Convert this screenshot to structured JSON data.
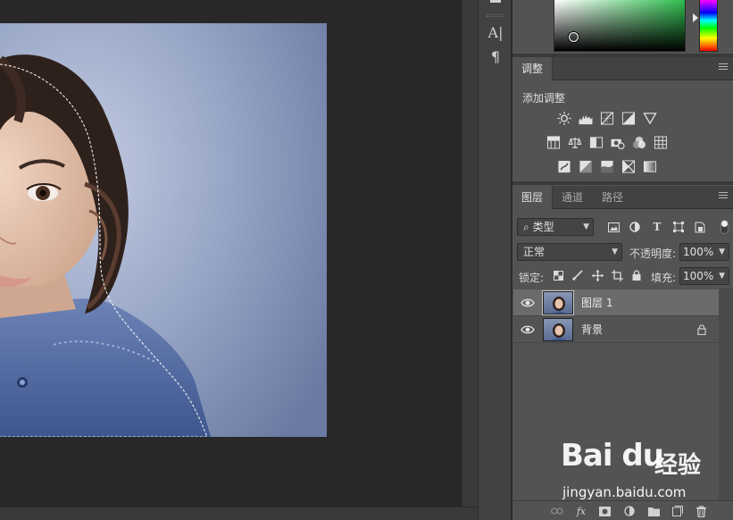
{
  "tools": {
    "type_tool": "A|",
    "paragraph_tool": "¶"
  },
  "adjustments": {
    "tab": "调整",
    "add_label": "添加调整",
    "icons": [
      "brightness-contrast-icon",
      "levels-icon",
      "curves-icon",
      "exposure-icon",
      "vibrance-icon",
      "hue-saturation-icon",
      "color-balance-icon",
      "black-white-icon",
      "photo-filter-icon",
      "channel-mixer-icon",
      "color-lookup-icon",
      "invert-icon",
      "posterize-icon",
      "threshold-icon",
      "selective-color-icon",
      "gradient-map-icon"
    ]
  },
  "layers_panel": {
    "tabs": [
      "图层",
      "通道",
      "路径"
    ],
    "filter": {
      "search_glyph": "⌕",
      "value": "类型"
    },
    "blend_mode": "正常",
    "opacity_label": "不透明度:",
    "opacity_value": "100%",
    "lock_label": "锁定:",
    "fill_label": "填充:",
    "fill_value": "100%",
    "layers": [
      {
        "name": "图层 1",
        "selected": true,
        "visible": true,
        "locked": false
      },
      {
        "name": "背景",
        "selected": false,
        "visible": true,
        "locked": true
      }
    ],
    "bottom_tools": [
      "link-icon",
      "fx-icon",
      "mask-icon",
      "adjustment-layer-icon",
      "group-icon",
      "new-layer-icon",
      "trash-icon"
    ],
    "fx_label": "fx"
  },
  "watermark": {
    "logo": "Bai du",
    "sub": "经验",
    "url": "jingyan.baidu.com"
  },
  "colors": {
    "canvas_bg": "#282828",
    "panel_bg": "#535353",
    "selected_layer": "#6b6b6b",
    "photo_bg": "#8a9bbd"
  }
}
